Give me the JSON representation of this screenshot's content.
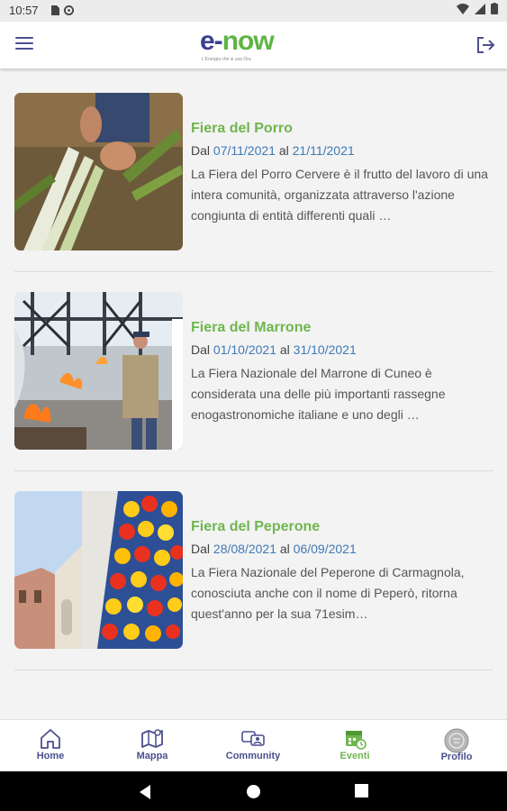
{
  "status_bar": {
    "time": "10:57"
  },
  "header": {
    "logo_main_e": "e-",
    "logo_main_now": "now",
    "logo_tagline": "L'Energia che si usa Ora"
  },
  "events": [
    {
      "title": "Fiera del Porro",
      "dal": "Dal",
      "start": "07/11/2021",
      "al": "al",
      "end": "21/11/2021",
      "description": "La Fiera del Porro Cervere è il frutto del lavoro di una intera comunità, organizzata attraverso l'azione congiunta di entità differenti quali …"
    },
    {
      "title": "Fiera del Marrone",
      "dal": "Dal",
      "start": "01/10/2021",
      "al": "al",
      "end": "31/10/2021",
      "description": "La Fiera Nazionale del Marrone di Cuneo è considerata una delle più importanti rassegne enogastronomiche italiane e uno degli …"
    },
    {
      "title": "Fiera del Peperone",
      "dal": "Dal",
      "start": "28/08/2021",
      "al": "al",
      "end": "06/09/2021",
      "description": "La Fiera Nazionale del Peperone di Carmagnola, conosciuta anche con il nome di Peperò, ritorna quest'anno per la sua 71esim…"
    }
  ],
  "bottom_nav": [
    {
      "label": "Home",
      "icon": "home-icon",
      "active": false
    },
    {
      "label": "Mappa",
      "icon": "map-icon",
      "active": false
    },
    {
      "label": "Community",
      "icon": "community-icon",
      "active": false
    },
    {
      "label": "Eventi",
      "icon": "calendar-icon",
      "active": true
    },
    {
      "label": "Profilo",
      "icon": "avatar-icon",
      "active": false
    }
  ],
  "colors": {
    "accent_green": "#6fb64f",
    "brand_blue": "#3b3f92",
    "date_link": "#3e79b5",
    "nav_text": "#4b4f8d"
  }
}
